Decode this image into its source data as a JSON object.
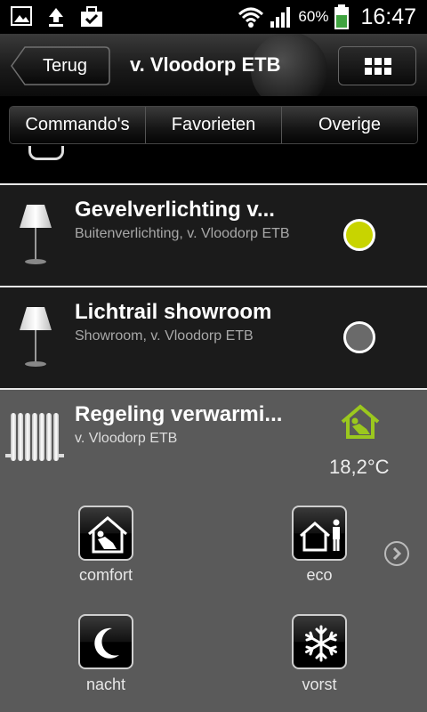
{
  "status_bar": {
    "battery_percent": "60%",
    "time": "16:47",
    "icons": [
      "image-icon",
      "upload-icon",
      "briefcase-check-icon",
      "wifi-icon",
      "signal-icon",
      "battery-icon"
    ]
  },
  "header": {
    "back_label": "Terug",
    "title": "v. Vloodorp ETB",
    "menu_icon": "grid-icon"
  },
  "tabs": [
    {
      "label": "Commando's"
    },
    {
      "label": "Favorieten"
    },
    {
      "label": "Overige"
    }
  ],
  "items": [
    {
      "title": "Gevelverlichting v...",
      "subtitle": "Buitenverlichting, v. Vloodorp ETB",
      "icon": "floor-lamp-icon",
      "status_color": "#c8d400"
    },
    {
      "title": "Lichtrail showroom",
      "subtitle": "Showroom, v. Vloodorp ETB",
      "icon": "floor-lamp-icon",
      "status_color": "#6a6a6a"
    }
  ],
  "heating": {
    "title": "Regeling verwarmi...",
    "subtitle": "v. Vloodorp ETB",
    "temperature": "18,2°C",
    "status_icon_color": "#9bc81e",
    "modes": [
      {
        "label": "comfort",
        "icon": "comfort-icon"
      },
      {
        "label": "eco",
        "icon": "eco-icon"
      },
      {
        "label": "nacht",
        "icon": "moon-icon"
      },
      {
        "label": "vorst",
        "icon": "snowflake-icon"
      }
    ]
  },
  "colors": {
    "accent_green": "#9bc81e",
    "separator": "#e8e8e8",
    "row_background": "#1b1b1b",
    "panel_background": "#5a5a5a"
  }
}
